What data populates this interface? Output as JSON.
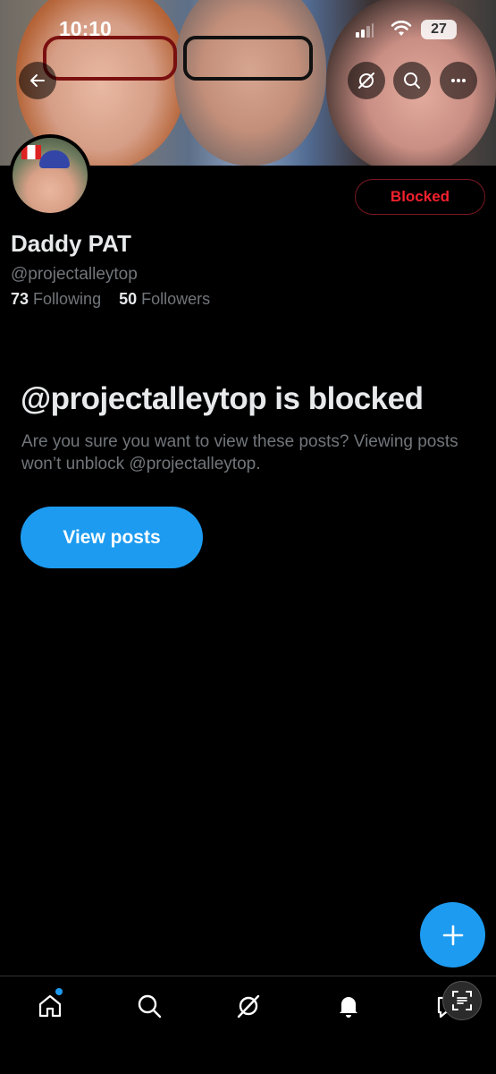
{
  "status_bar": {
    "time": "10:10",
    "battery": "27"
  },
  "header": {
    "icons": [
      "back-arrow-icon",
      "grok-icon",
      "search-icon",
      "more-icon"
    ]
  },
  "profile": {
    "name": "Daddy PAT",
    "handle": "@projectalleytop",
    "following_count": "73",
    "following_label": "Following",
    "followers_count": "50",
    "followers_label": "Followers",
    "blocked_label": "Blocked"
  },
  "blocked_notice": {
    "title": "@projectalleytop is blocked",
    "description": "Are you sure you want to view these posts? Viewing posts won’t unblock @projectalleytop.",
    "button_label": "View posts"
  },
  "bottom_nav": {
    "items": [
      "home-icon",
      "search-icon",
      "grok-icon",
      "notifications-icon",
      "messages-icon"
    ]
  },
  "colors": {
    "accent": "#1d9bf0",
    "blocked_red": "#f4212e",
    "muted": "#71767b"
  }
}
